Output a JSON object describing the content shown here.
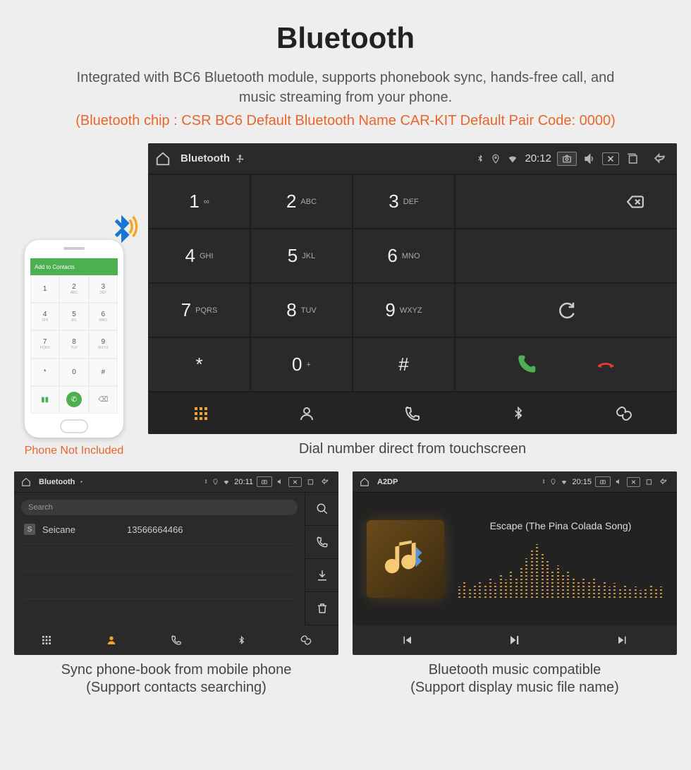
{
  "header": {
    "title": "Bluetooth",
    "subtitle": "Integrated with BC6 Bluetooth module, supports phonebook sync, hands-free call, and music streaming from your phone.",
    "spec_line": "(Bluetooth chip : CSR BC6    Default Bluetooth Name CAR-KIT    Default Pair Code: 0000)"
  },
  "phone_mock": {
    "top_bar": "Add to Contacts",
    "caption": "Phone Not Included"
  },
  "dialer": {
    "statusbar": {
      "title": "Bluetooth",
      "time": "20:12"
    },
    "keys": [
      {
        "digit": "1",
        "letters": "∞"
      },
      {
        "digit": "2",
        "letters": "ABC"
      },
      {
        "digit": "3",
        "letters": "DEF"
      },
      {
        "digit": "4",
        "letters": "GHI"
      },
      {
        "digit": "5",
        "letters": "JKL"
      },
      {
        "digit": "6",
        "letters": "MNO"
      },
      {
        "digit": "7",
        "letters": "PQRS"
      },
      {
        "digit": "8",
        "letters": "TUV"
      },
      {
        "digit": "9",
        "letters": "WXYZ"
      },
      {
        "digit": "*",
        "letters": ""
      },
      {
        "digit": "0",
        "letters": "+"
      },
      {
        "digit": "#",
        "letters": ""
      }
    ],
    "caption": "Dial number direct from touchscreen"
  },
  "contacts": {
    "statusbar": {
      "title": "Bluetooth",
      "time": "20:11"
    },
    "search_placeholder": "Search",
    "rows": [
      {
        "letter": "S",
        "name": "Seicane",
        "number": "13566664466"
      }
    ],
    "caption1": "Sync phone-book from mobile phone",
    "caption2": "(Support contacts searching)"
  },
  "music": {
    "statusbar": {
      "title": "A2DP",
      "time": "20:15"
    },
    "song": "Escape (The Pina Colada Song)",
    "caption1": "Bluetooth music compatible",
    "caption2": "(Support display music file name)"
  }
}
